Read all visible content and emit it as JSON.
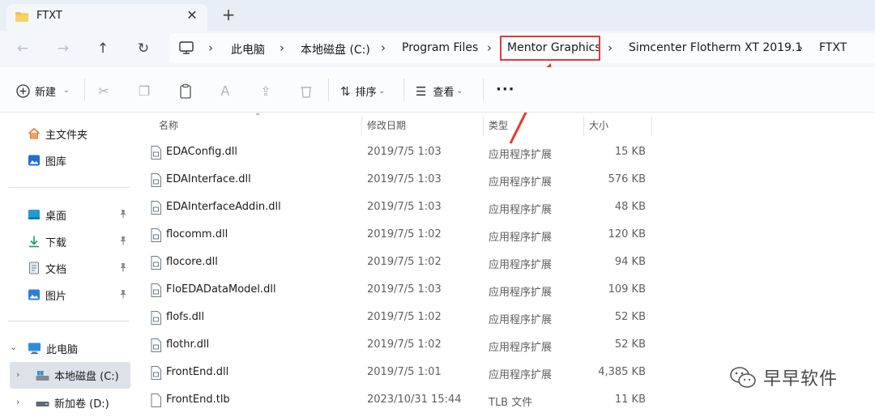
{
  "window": {
    "tab_title": "FTXT",
    "tab_close": "✕",
    "tab_new": "+"
  },
  "nav": {
    "back": "←",
    "forward": "→",
    "up": "↑",
    "refresh": "↻"
  },
  "breadcrumb": {
    "items": [
      "此电脑",
      "本地磁盘 (C:)",
      "Program Files",
      "Mentor Graphics",
      "Simcenter Flotherm XT 2019.1",
      "FTXT"
    ],
    "separator": "›",
    "highlight_color": "#e53935"
  },
  "toolbar": {
    "new_label": "新建",
    "sort_label": "排序",
    "view_label": "查看",
    "more_label": "···"
  },
  "sidebar": {
    "items": [
      {
        "label": "主文件夹",
        "icon": "home-icon"
      },
      {
        "label": "图库",
        "icon": "gallery-icon"
      },
      {
        "label": "桌面",
        "icon": "desktop-icon",
        "pinned": true
      },
      {
        "label": "下载",
        "icon": "download-icon",
        "pinned": true
      },
      {
        "label": "文档",
        "icon": "document-icon",
        "pinned": true
      },
      {
        "label": "图片",
        "icon": "pictures-icon",
        "pinned": true
      },
      {
        "label": "此电脑",
        "icon": "computer-icon",
        "expanded": true
      },
      {
        "label": "本地磁盘 (C:)",
        "icon": "drive-icon",
        "selected": true
      },
      {
        "label": "新加卷 (D:)",
        "icon": "drive-icon"
      }
    ]
  },
  "columns": {
    "name": "名称",
    "date": "修改日期",
    "type": "类型",
    "size": "大小"
  },
  "files": [
    {
      "name": "EDAConfig.dll",
      "date": "2019/7/5 1:03",
      "type": "应用程序扩展",
      "size": "15 KB"
    },
    {
      "name": "EDAInterface.dll",
      "date": "2019/7/5 1:03",
      "type": "应用程序扩展",
      "size": "576 KB"
    },
    {
      "name": "EDAInterfaceAddin.dll",
      "date": "2019/7/5 1:03",
      "type": "应用程序扩展",
      "size": "48 KB"
    },
    {
      "name": "flocomm.dll",
      "date": "2019/7/5 1:02",
      "type": "应用程序扩展",
      "size": "120 KB"
    },
    {
      "name": "flocore.dll",
      "date": "2019/7/5 1:02",
      "type": "应用程序扩展",
      "size": "94 KB"
    },
    {
      "name": "FloEDADataModel.dll",
      "date": "2019/7/5 1:03",
      "type": "应用程序扩展",
      "size": "109 KB"
    },
    {
      "name": "flofs.dll",
      "date": "2019/7/5 1:02",
      "type": "应用程序扩展",
      "size": "52 KB"
    },
    {
      "name": "flothr.dll",
      "date": "2019/7/5 1:02",
      "type": "应用程序扩展",
      "size": "52 KB"
    },
    {
      "name": "FrontEnd.dll",
      "date": "2019/7/5 1:01",
      "type": "应用程序扩展",
      "size": "4,385 KB"
    },
    {
      "name": "FrontEnd.tlb",
      "date": "2023/10/31 15:44",
      "type": "TLB 文件",
      "size": "11 KB"
    }
  ],
  "watermark": {
    "text": "早早软件",
    "icon": "wechat-icon"
  }
}
